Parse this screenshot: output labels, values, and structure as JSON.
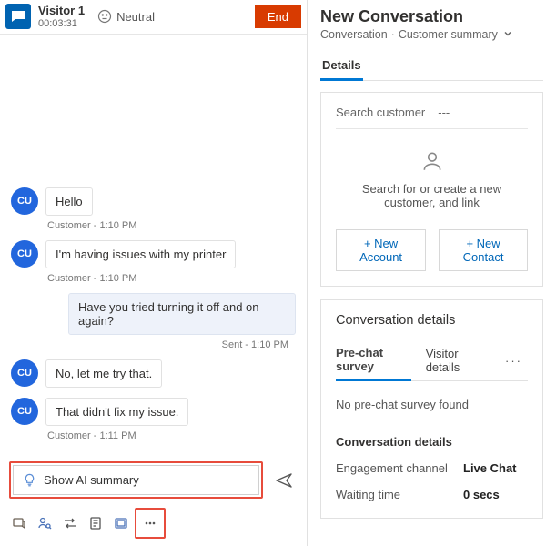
{
  "header": {
    "visitor_name": "Visitor 1",
    "timer": "00:03:31",
    "sentiment_label": "Neutral",
    "end_label": "End"
  },
  "avatar_initials": "CU",
  "messages": [
    {
      "from": "customer",
      "text": "Hello",
      "meta": "Customer - 1:10 PM",
      "show_avatar": true
    },
    {
      "from": "customer",
      "text": "I'm having issues with my printer",
      "meta": "Customer - 1:10 PM",
      "show_avatar": true
    },
    {
      "from": "agent",
      "text": "Have you tried turning it off and on again?",
      "meta": "Sent - 1:10 PM"
    },
    {
      "from": "customer",
      "text": "No, let me try that.",
      "meta": "",
      "show_avatar": true
    },
    {
      "from": "customer",
      "text": "That didn't fix my issue.",
      "meta": "Customer - 1:11 PM",
      "show_avatar": true
    }
  ],
  "ai_summary_label": "Show AI summary",
  "right": {
    "title": "New Conversation",
    "breadcrumb_conversation": "Conversation",
    "breadcrumb_summary": "Customer summary",
    "details_tab": "Details",
    "search_customer_label": "Search customer",
    "search_customer_value": "---",
    "customer_hint": "Search for or create a new customer, and link",
    "new_account_label": "+ New Account",
    "new_contact_label": "+ New Contact",
    "conv_details_title": "Conversation details",
    "inner_tabs": {
      "prechat": "Pre-chat survey",
      "visitor": "Visitor details"
    },
    "no_survey_text": "No pre-chat survey found",
    "sub_heading": "Conversation details",
    "engagement_label": "Engagement channel",
    "engagement_value": "Live Chat",
    "waiting_label": "Waiting time",
    "waiting_value": "0 secs"
  }
}
